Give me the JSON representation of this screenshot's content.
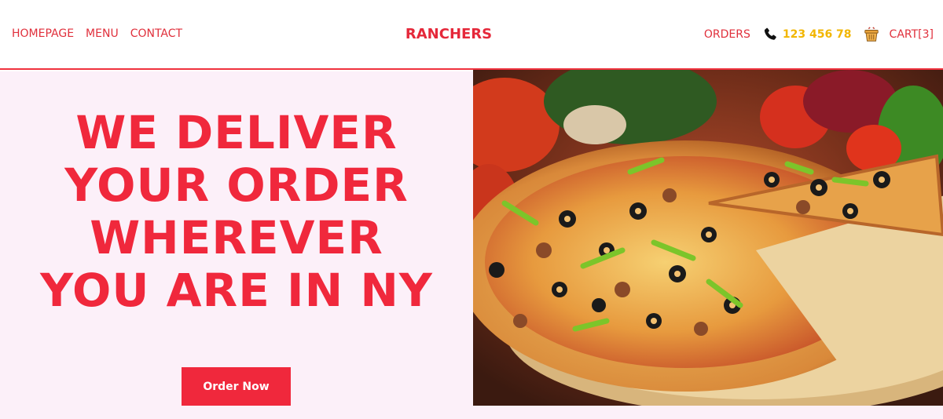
{
  "nav": {
    "left_links": [
      "HOMEPAGE",
      "MENU",
      "CONTACT"
    ],
    "brand": "RANCHERS",
    "orders": "ORDERS",
    "phone_icon": "phone-icon",
    "phone": "123 456 78",
    "cart_icon": "basket-icon",
    "cart": "CART[3]"
  },
  "hero": {
    "title_lines": [
      "WE DELIVER",
      "YOUR ORDER",
      "WHEREVER",
      "YOU ARE IN NY"
    ],
    "cta": "Order Now",
    "image": "pizza-photo"
  },
  "colors": {
    "accent": "#f0283c",
    "phone": "#f2b600",
    "hero_bg": "#fcf0f9"
  }
}
